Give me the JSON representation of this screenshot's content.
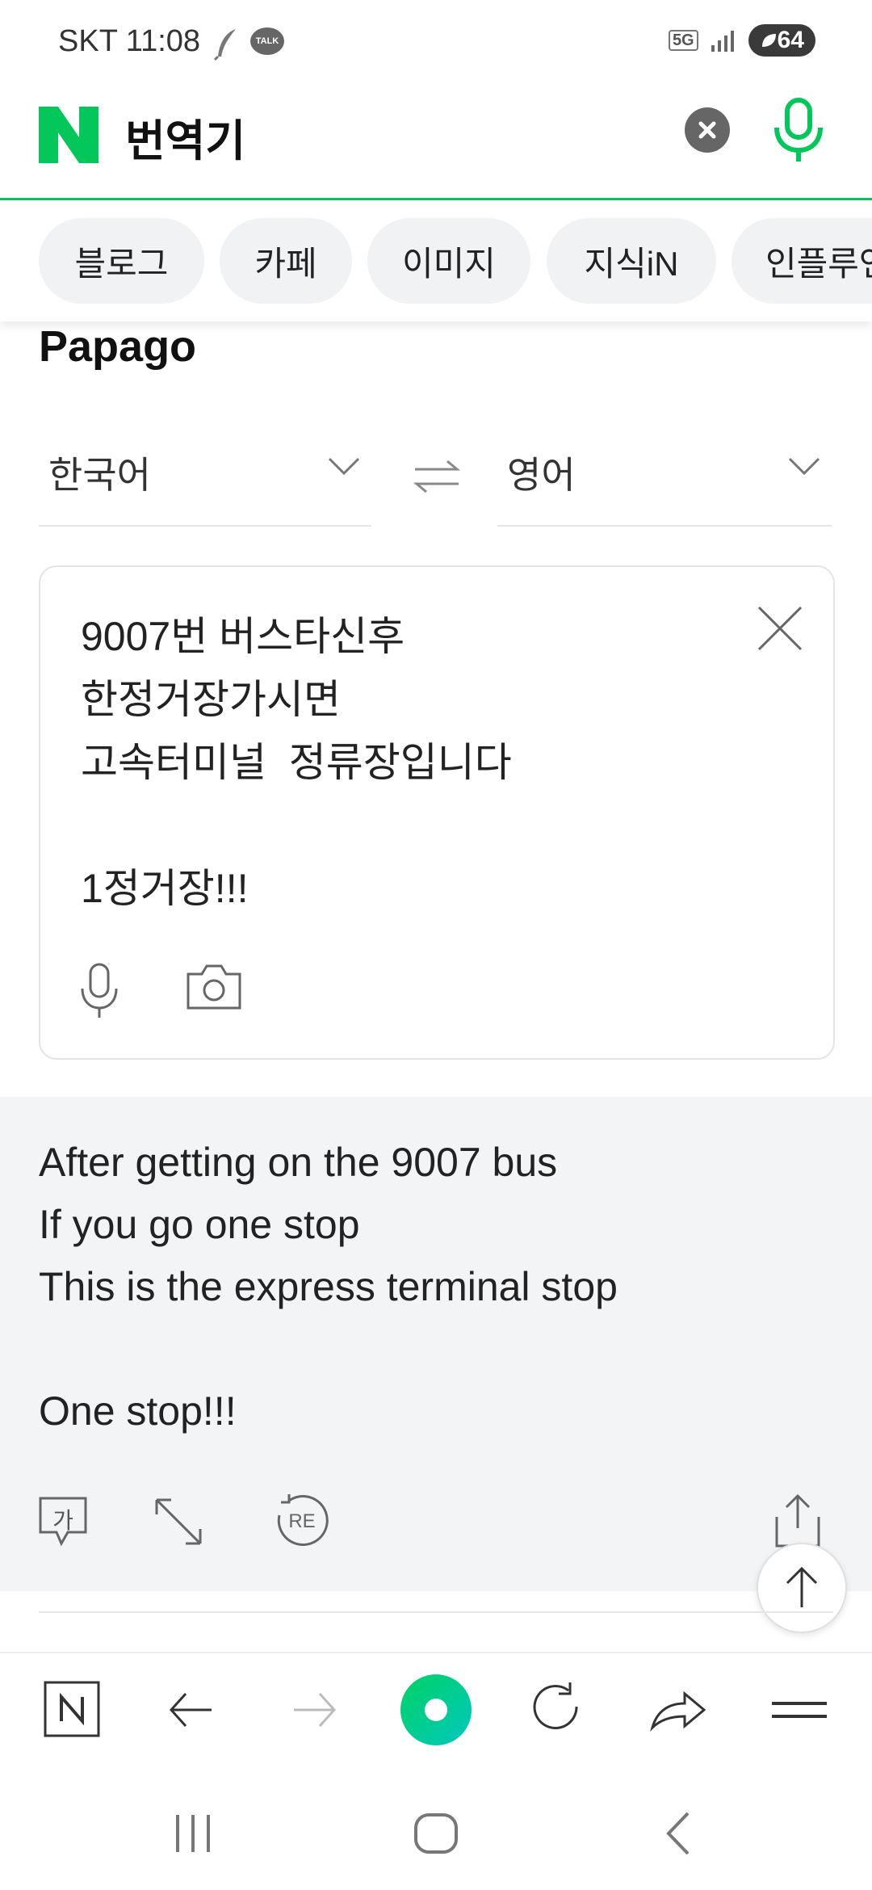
{
  "status_bar": {
    "carrier": "SKT",
    "time": "11:08",
    "network": "5G",
    "battery": "64",
    "notification_icons": [
      "feather-icon",
      "kakaotalk-icon"
    ],
    "talk_label": "TALK"
  },
  "header": {
    "logo": "N",
    "title": "번역기"
  },
  "tabs": [
    "블로그",
    "카페",
    "이미지",
    "지식iN",
    "인플루언서"
  ],
  "papago": {
    "title": "Papago",
    "source_lang": "한국어",
    "target_lang": "영어",
    "source_text": [
      "9007번 버스타신후",
      "한정거장가시면",
      "고속터미널  정류장입니다",
      "",
      "1정거장!!!"
    ],
    "translated_text": [
      "After getting on the 9007 bus",
      "If you go one stop",
      "This is the express terminal stop",
      "",
      "One stop!!!"
    ],
    "result_icons": {
      "honorific_label": "가",
      "retranslate_label": "RE"
    }
  },
  "colors": {
    "brand_green": "#03c75a",
    "result_bg": "#f3f4f6",
    "chip_bg": "#f1f2f4"
  }
}
